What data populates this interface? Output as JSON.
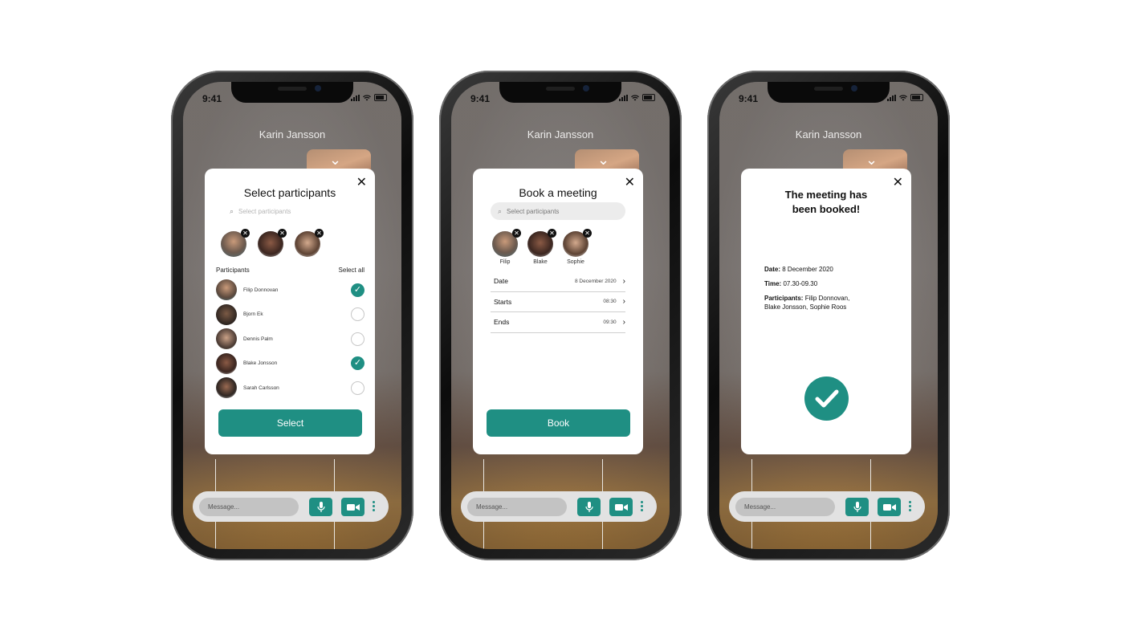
{
  "status": {
    "time": "9:41"
  },
  "call": {
    "caller_name": "Karin Jansson",
    "message_placeholder": "Message..."
  },
  "screen1": {
    "title": "Select participants",
    "search_placeholder": "Select participants",
    "participants_label": "Participants",
    "select_all_label": "Select all",
    "participants": [
      {
        "name": "Filip Donnovan",
        "checked": true
      },
      {
        "name": "Bjorn Ek",
        "checked": false
      },
      {
        "name": "Dennis Palm",
        "checked": false
      },
      {
        "name": "Blake Jonsson",
        "checked": true
      },
      {
        "name": "Sarah Carlsson",
        "checked": false
      }
    ],
    "button_label": "Select"
  },
  "screen2": {
    "title": "Book a meeting",
    "search_placeholder": "Select participants",
    "chips": [
      "Filip",
      "Blake",
      "Sophie"
    ],
    "fields": [
      {
        "label": "Date",
        "value": "8 December 2020"
      },
      {
        "label": "Starts",
        "value": "08:30"
      },
      {
        "label": "Ends",
        "value": "09:30"
      }
    ],
    "button_label": "Book"
  },
  "screen3": {
    "title_line1": "The meeting has",
    "title_line2": "been booked!",
    "date_label": "Date:",
    "date_value": "8 December 2020",
    "time_label": "Time:",
    "time_value": "07.30-09.30",
    "participants_label": "Participants:",
    "participants_value_line1": "Filip Donnovan,",
    "participants_value_line2": "Blake Jonsson, Sophie Roos"
  },
  "colors": {
    "accent": "#1f8f83",
    "modal_bg": "#ffffff",
    "bar_bg": "#e2e2e2"
  },
  "icons": [
    "close-icon",
    "search-icon",
    "remove-icon",
    "check-icon",
    "chevron-right-icon",
    "chevron-down-icon",
    "mic-icon",
    "video-icon",
    "more-icon"
  ]
}
